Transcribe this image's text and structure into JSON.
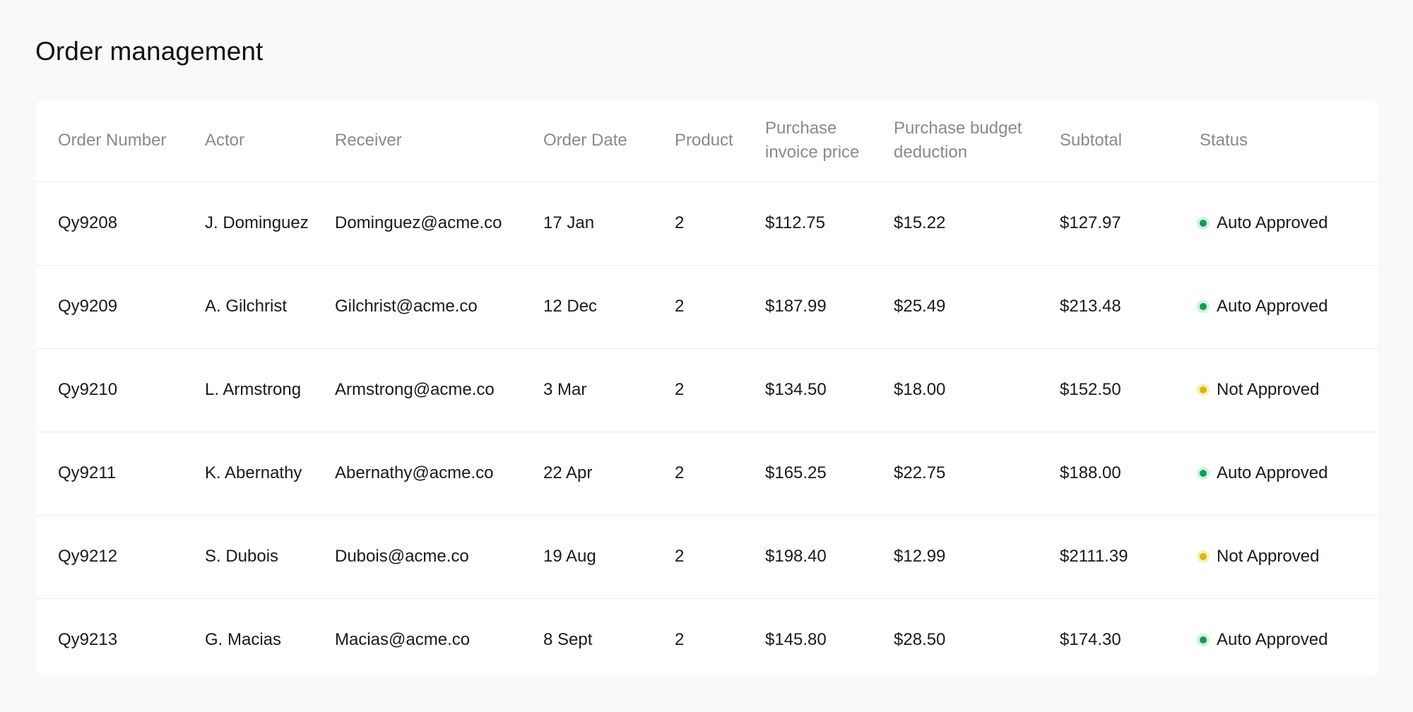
{
  "page": {
    "title": "Order management"
  },
  "table": {
    "columns": [
      "Order Number",
      "Actor",
      "Receiver",
      "Order Date",
      "Product",
      "Purchase invoice price",
      "Purchase budget deduction",
      "Subtotal",
      "Status"
    ],
    "rows": [
      [
        "Qy9208",
        "J. Dominguez",
        "Dominguez@acme.co",
        "17 Jan",
        "2",
        "$112.75",
        "$15.22",
        "$127.97",
        "Auto Approved"
      ],
      [
        "Qy9209",
        "A. Gilchrist",
        "Gilchrist@acme.co",
        "12 Dec",
        "2",
        "$187.99",
        "$25.49",
        "$213.48",
        "Auto Approved"
      ],
      [
        "Qy9210",
        "L. Armstrong",
        "Armstrong@acme.co",
        "3 Mar",
        "2",
        "$134.50",
        "$18.00",
        "$152.50",
        "Not Approved"
      ],
      [
        "Qy9211",
        "K. Abernathy",
        "Abernathy@acme.co",
        "22 Apr",
        "2",
        "$165.25",
        "$22.75",
        "$188.00",
        "Auto Approved"
      ],
      [
        "Qy9212",
        "S. Dubois",
        "Dubois@acme.co",
        "19 Aug",
        "2",
        "$198.40",
        "$12.99",
        "$2111.39",
        "Not Approved"
      ],
      [
        "Qy9213",
        "G. Macias",
        "Macias@acme.co",
        "8 Sept",
        "2",
        "$145.80",
        "$28.50",
        "$174.30",
        "Auto Approved"
      ]
    ]
  },
  "status_colors": {
    "Auto Approved": "#0f9d58",
    "Not Approved": "#d9b70d"
  }
}
